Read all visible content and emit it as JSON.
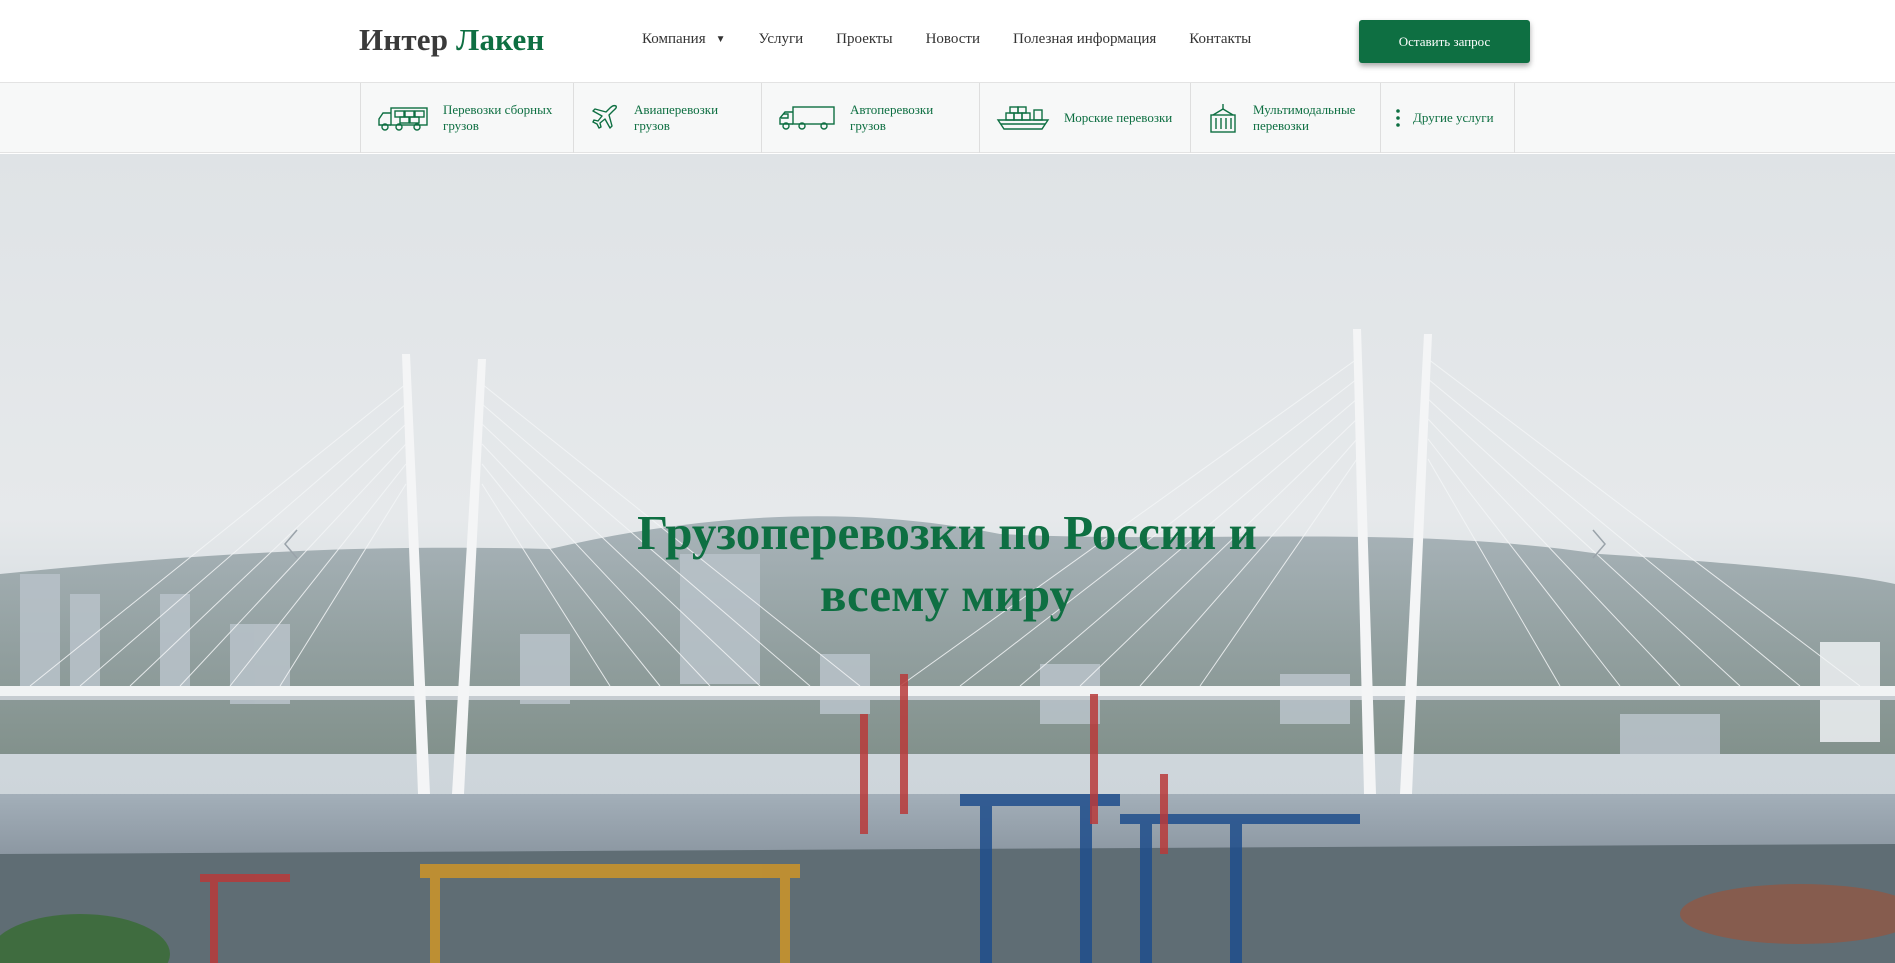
{
  "header": {
    "logo": {
      "part1": "Интер",
      "part2": "Лакен"
    },
    "nav": [
      {
        "label": "Компания",
        "has_dropdown": true
      },
      {
        "label": "Услуги"
      },
      {
        "label": "Проекты"
      },
      {
        "label": "Новости"
      },
      {
        "label": "Полезная информация"
      },
      {
        "label": "Контакты"
      }
    ],
    "cta_label": "Оставить запрос"
  },
  "services": [
    {
      "line1": "Перевозки сборных",
      "line2": "грузов",
      "icon": "truck-cargo-icon"
    },
    {
      "line1": "Авиаперевозки",
      "line2": "грузов",
      "icon": "airplane-icon"
    },
    {
      "line1": "Автоперевозки",
      "line2": "грузов",
      "icon": "truck-icon"
    },
    {
      "line1": "Морские перевозки",
      "line2": "",
      "icon": "ship-icon"
    },
    {
      "line1": "Мультимодальные",
      "line2": "перевозки",
      "icon": "container-crane-icon"
    },
    {
      "line1": "Другие услуги",
      "line2": "",
      "icon": "more-dots-icon"
    }
  ],
  "hero": {
    "title_line1": "Грузоперевозки по России и",
    "title_line2": "всему миру"
  },
  "colors": {
    "brand_green": "#0e6f42",
    "text_dark": "#333333",
    "bar_bg": "#f7f8f8"
  }
}
